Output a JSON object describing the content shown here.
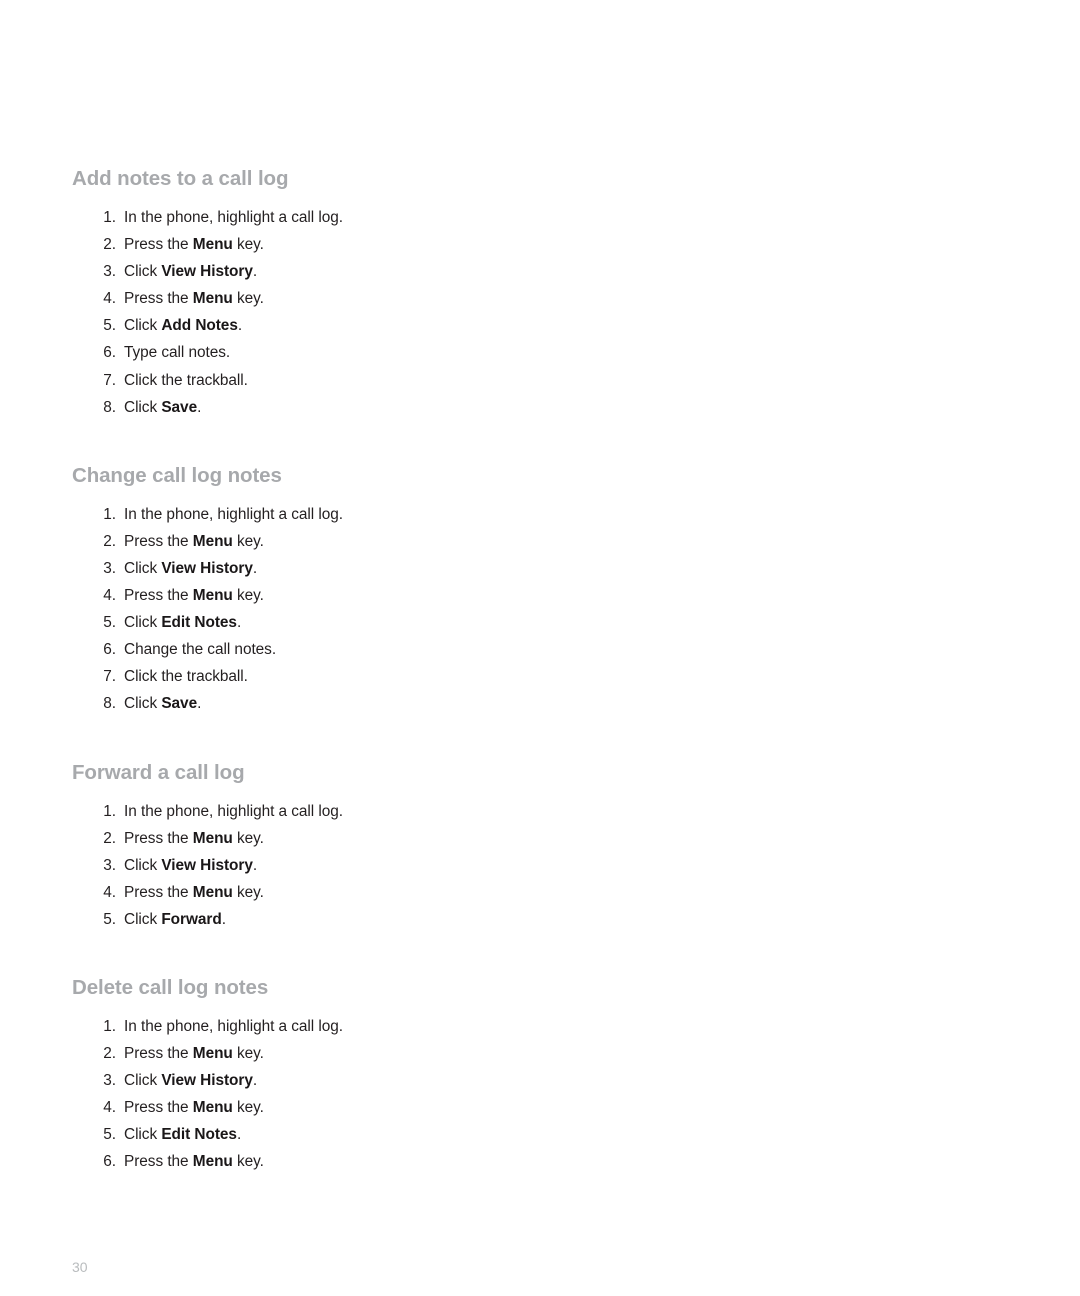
{
  "page": {
    "number": "30",
    "background": "#ffffff",
    "heading_color": "#a7a9ac",
    "body_color": "#231f20",
    "page_number_color": "#b9bcbe"
  },
  "sections": [
    {
      "heading": "Add notes to a call log",
      "steps": [
        {
          "parts": [
            {
              "t": "In the phone, highlight a call log.",
              "b": false
            }
          ]
        },
        {
          "parts": [
            {
              "t": "Press the ",
              "b": false
            },
            {
              "t": "Menu",
              "b": true
            },
            {
              "t": " key.",
              "b": false
            }
          ]
        },
        {
          "parts": [
            {
              "t": "Click ",
              "b": false
            },
            {
              "t": "View History",
              "b": true
            },
            {
              "t": ".",
              "b": false
            }
          ]
        },
        {
          "parts": [
            {
              "t": "Press the ",
              "b": false
            },
            {
              "t": "Menu",
              "b": true
            },
            {
              "t": " key.",
              "b": false
            }
          ]
        },
        {
          "parts": [
            {
              "t": "Click ",
              "b": false
            },
            {
              "t": "Add Notes",
              "b": true
            },
            {
              "t": ".",
              "b": false
            }
          ]
        },
        {
          "parts": [
            {
              "t": "Type call notes.",
              "b": false
            }
          ]
        },
        {
          "parts": [
            {
              "t": "Click the trackball.",
              "b": false
            }
          ]
        },
        {
          "parts": [
            {
              "t": "Click ",
              "b": false
            },
            {
              "t": "Save",
              "b": true
            },
            {
              "t": ".",
              "b": false
            }
          ]
        }
      ]
    },
    {
      "heading": "Change call log notes",
      "steps": [
        {
          "parts": [
            {
              "t": "In the phone, highlight a call log.",
              "b": false
            }
          ]
        },
        {
          "parts": [
            {
              "t": "Press the ",
              "b": false
            },
            {
              "t": "Menu",
              "b": true
            },
            {
              "t": " key.",
              "b": false
            }
          ]
        },
        {
          "parts": [
            {
              "t": "Click ",
              "b": false
            },
            {
              "t": "View History",
              "b": true
            },
            {
              "t": ".",
              "b": false
            }
          ]
        },
        {
          "parts": [
            {
              "t": "Press the ",
              "b": false
            },
            {
              "t": "Menu",
              "b": true
            },
            {
              "t": " key.",
              "b": false
            }
          ]
        },
        {
          "parts": [
            {
              "t": "Click ",
              "b": false
            },
            {
              "t": "Edit Notes",
              "b": true
            },
            {
              "t": ".",
              "b": false
            }
          ]
        },
        {
          "parts": [
            {
              "t": "Change the call notes.",
              "b": false
            }
          ]
        },
        {
          "parts": [
            {
              "t": "Click the trackball.",
              "b": false
            }
          ]
        },
        {
          "parts": [
            {
              "t": "Click ",
              "b": false
            },
            {
              "t": "Save",
              "b": true
            },
            {
              "t": ".",
              "b": false
            }
          ]
        }
      ]
    },
    {
      "heading": "Forward a call log",
      "steps": [
        {
          "parts": [
            {
              "t": "In the phone, highlight a call log.",
              "b": false
            }
          ]
        },
        {
          "parts": [
            {
              "t": "Press the ",
              "b": false
            },
            {
              "t": "Menu",
              "b": true
            },
            {
              "t": " key.",
              "b": false
            }
          ]
        },
        {
          "parts": [
            {
              "t": "Click ",
              "b": false
            },
            {
              "t": "View History",
              "b": true
            },
            {
              "t": ".",
              "b": false
            }
          ]
        },
        {
          "parts": [
            {
              "t": "Press the ",
              "b": false
            },
            {
              "t": "Menu",
              "b": true
            },
            {
              "t": " key.",
              "b": false
            }
          ]
        },
        {
          "parts": [
            {
              "t": "Click ",
              "b": false
            },
            {
              "t": "Forward",
              "b": true
            },
            {
              "t": ".",
              "b": false
            }
          ]
        }
      ]
    },
    {
      "heading": "Delete call log notes",
      "steps": [
        {
          "parts": [
            {
              "t": "In the phone, highlight a call log.",
              "b": false
            }
          ]
        },
        {
          "parts": [
            {
              "t": "Press the ",
              "b": false
            },
            {
              "t": "Menu",
              "b": true
            },
            {
              "t": " key.",
              "b": false
            }
          ]
        },
        {
          "parts": [
            {
              "t": "Click ",
              "b": false
            },
            {
              "t": "View History",
              "b": true
            },
            {
              "t": ".",
              "b": false
            }
          ]
        },
        {
          "parts": [
            {
              "t": "Press the ",
              "b": false
            },
            {
              "t": "Menu",
              "b": true
            },
            {
              "t": " key.",
              "b": false
            }
          ]
        },
        {
          "parts": [
            {
              "t": "Click ",
              "b": false
            },
            {
              "t": "Edit Notes",
              "b": true
            },
            {
              "t": ".",
              "b": false
            }
          ]
        },
        {
          "parts": [
            {
              "t": "Press the ",
              "b": false
            },
            {
              "t": "Menu",
              "b": true
            },
            {
              "t": " key.",
              "b": false
            }
          ]
        }
      ]
    }
  ]
}
